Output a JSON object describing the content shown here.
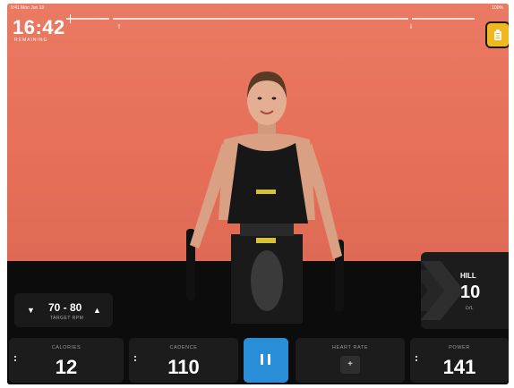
{
  "status_bar": {
    "left": "9:41  Mon Jun 10",
    "right": "100%"
  },
  "timer": {
    "value": "16:42",
    "label": "REMAINING"
  },
  "hill": {
    "title": "HILL",
    "value": "10",
    "unit": "LVL"
  },
  "target": {
    "range": "70 - 80",
    "label": "TARGET RPM",
    "down_icon": "chevron-down-icon",
    "up_icon": "chevron-up-icon"
  },
  "metrics": {
    "calories": {
      "label": "CALORIES",
      "value": "12"
    },
    "cadence": {
      "label": "CADENCE",
      "value": "110"
    },
    "heart_rate": {
      "label": "HEART RATE",
      "add_label": "+"
    },
    "power": {
      "label": "POWER",
      "value": "141"
    }
  },
  "colors": {
    "accent_blue": "#2a8dd8",
    "accent_yellow": "#f0b81e",
    "backdrop": "#e8735d"
  },
  "icons": {
    "top_button": "battery-icon",
    "pause": "pause-icon"
  }
}
